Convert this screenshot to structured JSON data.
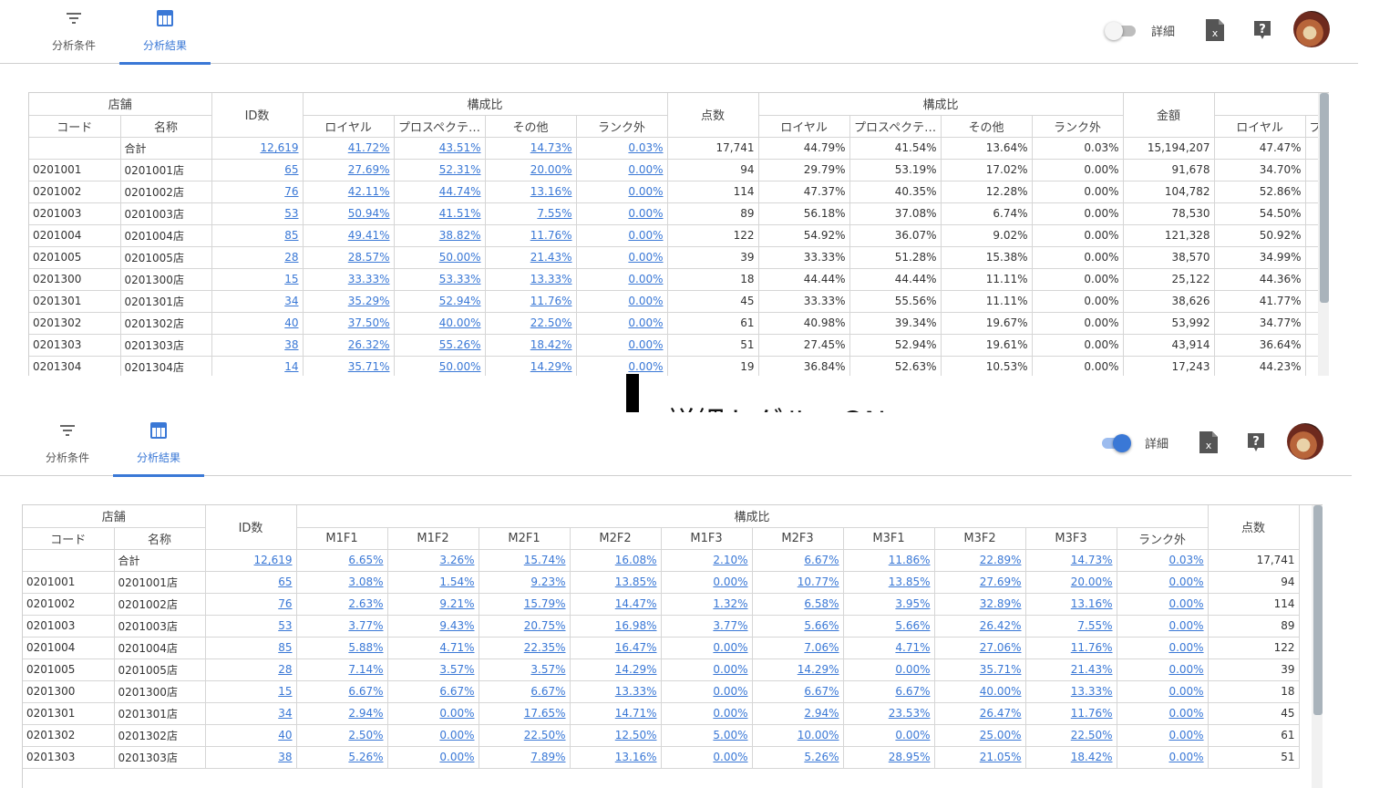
{
  "annotation": "詳細トグル　ON",
  "tabs": {
    "conditions": "分析条件",
    "results": "分析結果"
  },
  "detail_label": "詳細",
  "top": {
    "header_store": "店舗",
    "header_code": "コード",
    "header_name": "名称",
    "header_id": "ID数",
    "header_comp1": "構成比",
    "header_points": "点数",
    "header_comp2": "構成比",
    "header_amount": "金額",
    "sub1": [
      "ロイヤル",
      "プロスペクテ…",
      "その他",
      "ランク外"
    ],
    "sub2": [
      "ロイヤル",
      "プロスペクテ…",
      "その他",
      "ランク外"
    ],
    "sub3": [
      "ロイヤル",
      "プ"
    ],
    "rows": [
      [
        "",
        "合計",
        "12,619",
        "41.72%",
        "43.51%",
        "14.73%",
        "0.03%",
        "17,741",
        "44.79%",
        "41.54%",
        "13.64%",
        "0.03%",
        "15,194,207",
        "47.47%",
        ""
      ],
      [
        "0201001",
        "0201001店",
        "65",
        "27.69%",
        "52.31%",
        "20.00%",
        "0.00%",
        "94",
        "29.79%",
        "53.19%",
        "17.02%",
        "0.00%",
        "91,678",
        "34.70%",
        ""
      ],
      [
        "0201002",
        "0201002店",
        "76",
        "42.11%",
        "44.74%",
        "13.16%",
        "0.00%",
        "114",
        "47.37%",
        "40.35%",
        "12.28%",
        "0.00%",
        "104,782",
        "52.86%",
        ""
      ],
      [
        "0201003",
        "0201003店",
        "53",
        "50.94%",
        "41.51%",
        "7.55%",
        "0.00%",
        "89",
        "56.18%",
        "37.08%",
        "6.74%",
        "0.00%",
        "78,530",
        "54.50%",
        ""
      ],
      [
        "0201004",
        "0201004店",
        "85",
        "49.41%",
        "38.82%",
        "11.76%",
        "0.00%",
        "122",
        "54.92%",
        "36.07%",
        "9.02%",
        "0.00%",
        "121,328",
        "50.92%",
        ""
      ],
      [
        "0201005",
        "0201005店",
        "28",
        "28.57%",
        "50.00%",
        "21.43%",
        "0.00%",
        "39",
        "33.33%",
        "51.28%",
        "15.38%",
        "0.00%",
        "38,570",
        "34.99%",
        ""
      ],
      [
        "0201300",
        "0201300店",
        "15",
        "33.33%",
        "53.33%",
        "13.33%",
        "0.00%",
        "18",
        "44.44%",
        "44.44%",
        "11.11%",
        "0.00%",
        "25,122",
        "44.36%",
        ""
      ],
      [
        "0201301",
        "0201301店",
        "34",
        "35.29%",
        "52.94%",
        "11.76%",
        "0.00%",
        "45",
        "33.33%",
        "55.56%",
        "11.11%",
        "0.00%",
        "38,626",
        "41.77%",
        ""
      ],
      [
        "0201302",
        "0201302店",
        "40",
        "37.50%",
        "40.00%",
        "22.50%",
        "0.00%",
        "61",
        "40.98%",
        "39.34%",
        "19.67%",
        "0.00%",
        "53,992",
        "34.77%",
        ""
      ],
      [
        "0201303",
        "0201303店",
        "38",
        "26.32%",
        "55.26%",
        "18.42%",
        "0.00%",
        "51",
        "27.45%",
        "52.94%",
        "19.61%",
        "0.00%",
        "43,914",
        "36.64%",
        ""
      ],
      [
        "0201304",
        "0201304店",
        "14",
        "35.71%",
        "50.00%",
        "14.29%",
        "0.00%",
        "19",
        "36.84%",
        "52.63%",
        "10.53%",
        "0.00%",
        "17,243",
        "44.23%",
        ""
      ]
    ]
  },
  "bottom": {
    "header_store": "店舗",
    "header_code": "コード",
    "header_name": "名称",
    "header_id": "ID数",
    "header_comp": "構成比",
    "header_points": "点数",
    "sub": [
      "M1F1",
      "M1F2",
      "M2F1",
      "M2F2",
      "M1F3",
      "M2F3",
      "M3F1",
      "M3F2",
      "M3F3",
      "ランク外"
    ],
    "rows": [
      [
        "",
        "合計",
        "12,619",
        "6.65%",
        "3.26%",
        "15.74%",
        "16.08%",
        "2.10%",
        "6.67%",
        "11.86%",
        "22.89%",
        "14.73%",
        "0.03%",
        "17,741"
      ],
      [
        "0201001",
        "0201001店",
        "65",
        "3.08%",
        "1.54%",
        "9.23%",
        "13.85%",
        "0.00%",
        "10.77%",
        "13.85%",
        "27.69%",
        "20.00%",
        "0.00%",
        "94"
      ],
      [
        "0201002",
        "0201002店",
        "76",
        "2.63%",
        "9.21%",
        "15.79%",
        "14.47%",
        "1.32%",
        "6.58%",
        "3.95%",
        "32.89%",
        "13.16%",
        "0.00%",
        "114"
      ],
      [
        "0201003",
        "0201003店",
        "53",
        "3.77%",
        "9.43%",
        "20.75%",
        "16.98%",
        "3.77%",
        "5.66%",
        "5.66%",
        "26.42%",
        "7.55%",
        "0.00%",
        "89"
      ],
      [
        "0201004",
        "0201004店",
        "85",
        "5.88%",
        "4.71%",
        "22.35%",
        "16.47%",
        "0.00%",
        "7.06%",
        "4.71%",
        "27.06%",
        "11.76%",
        "0.00%",
        "122"
      ],
      [
        "0201005",
        "0201005店",
        "28",
        "7.14%",
        "3.57%",
        "3.57%",
        "14.29%",
        "0.00%",
        "14.29%",
        "0.00%",
        "35.71%",
        "21.43%",
        "0.00%",
        "39"
      ],
      [
        "0201300",
        "0201300店",
        "15",
        "6.67%",
        "6.67%",
        "6.67%",
        "13.33%",
        "0.00%",
        "6.67%",
        "6.67%",
        "40.00%",
        "13.33%",
        "0.00%",
        "18"
      ],
      [
        "0201301",
        "0201301店",
        "34",
        "2.94%",
        "0.00%",
        "17.65%",
        "14.71%",
        "0.00%",
        "2.94%",
        "23.53%",
        "26.47%",
        "11.76%",
        "0.00%",
        "45"
      ],
      [
        "0201302",
        "0201302店",
        "40",
        "2.50%",
        "0.00%",
        "22.50%",
        "12.50%",
        "5.00%",
        "10.00%",
        "0.00%",
        "25.00%",
        "22.50%",
        "0.00%",
        "61"
      ],
      [
        "0201303",
        "0201303店",
        "38",
        "5.26%",
        "0.00%",
        "7.89%",
        "13.16%",
        "0.00%",
        "5.26%",
        "28.95%",
        "21.05%",
        "18.42%",
        "0.00%",
        "51"
      ]
    ]
  },
  "colors": {
    "accent": "#3a78d6",
    "link": "#3a78d6",
    "border": "#d6d6d6",
    "scrollbar": "#a9b3bb"
  }
}
